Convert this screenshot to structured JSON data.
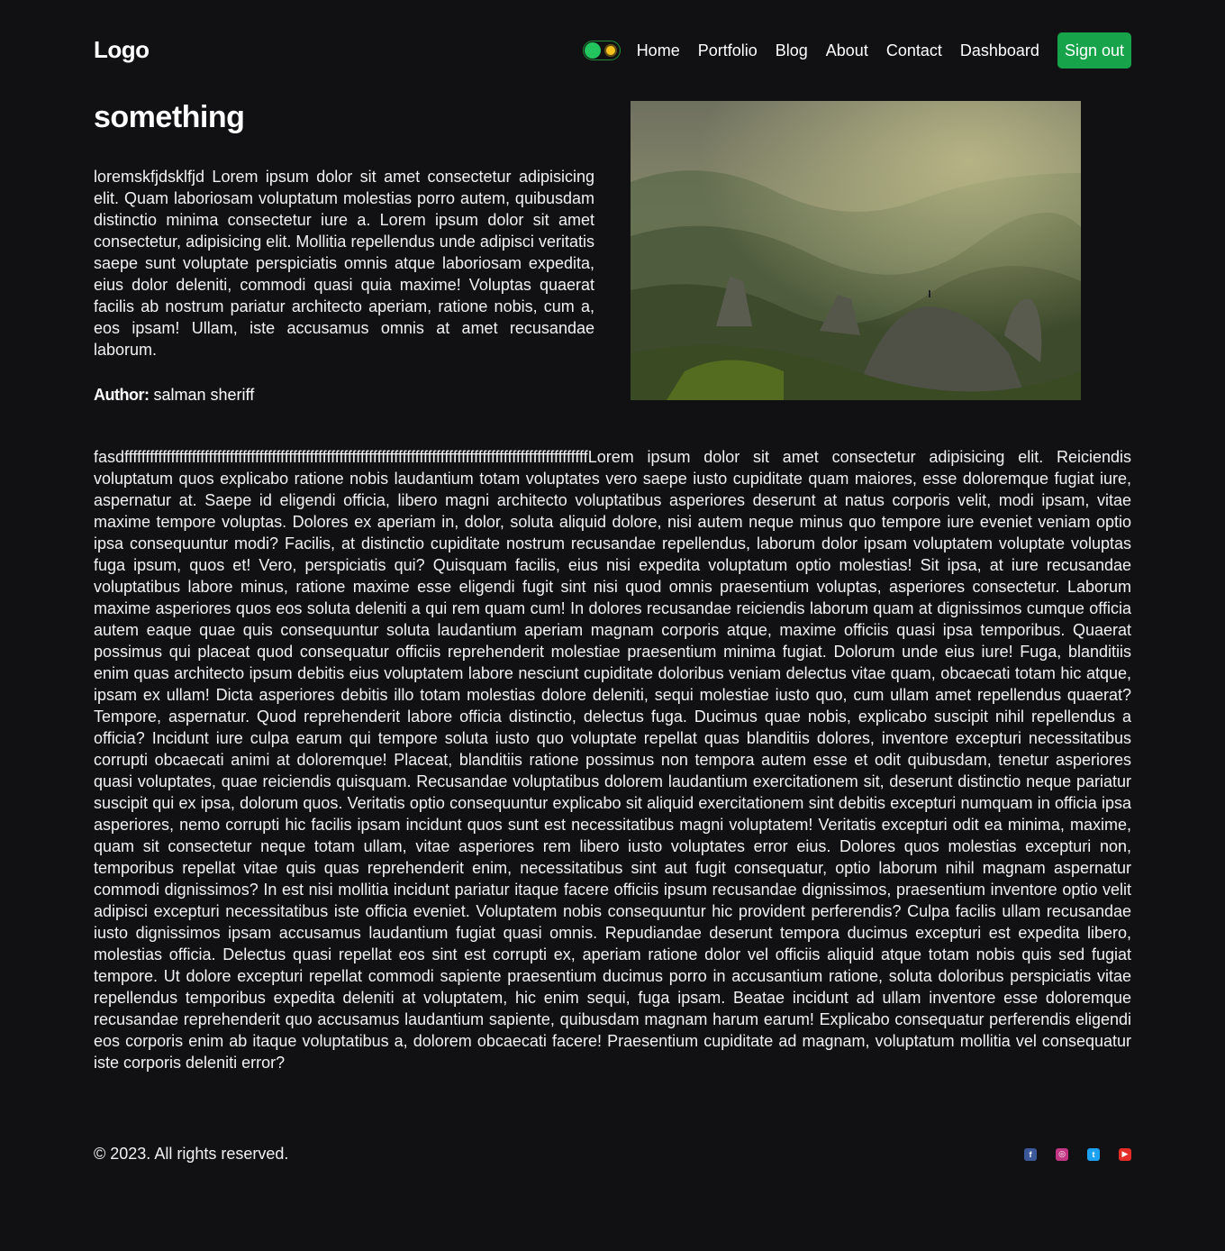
{
  "nav": {
    "logo": "Logo",
    "links": [
      "Home",
      "Portfolio",
      "Blog",
      "About",
      "Contact",
      "Dashboard"
    ],
    "signout": "Sign out"
  },
  "post": {
    "title": "something",
    "description": "loremskfjdsklfjd Lorem ipsum dolor sit amet consectetur adipisicing elit. Quam laboriosam voluptatum molestias porro autem, quibusdam distinctio minima consectetur iure a. Lorem ipsum dolor sit amet consectetur, adipisicing elit. Mollitia repellendus unde adipisci veritatis saepe sunt voluptate perspiciatis omnis atque laboriosam expedita, eius dolor deleniti, commodi quasi quia maxime! Voluptas quaerat facilis ab nostrum pariatur architecto aperiam, ratione nobis, cum a, eos ipsam! Ullam, iste accusamus omnis at amet recusandae laborum.",
    "author_label": "Author:",
    "author_name": "salman sheriff",
    "content_prefix": "fasdffffffffffffffffffffffffffffffffffffffffffffffffffffffffffffffffffffffffffffffffffffffffffffffffffffffffffffff",
    "content": "Lorem ipsum dolor sit amet consectetur adipisicing elit. Reiciendis voluptatum quos explicabo ratione nobis laudantium totam voluptates vero saepe iusto cupiditate quam maiores, esse doloremque fugiat iure, aspernatur at. Saepe id eligendi officia, libero magni architecto voluptatibus asperiores deserunt at natus corporis velit, modi ipsam, vitae maxime tempore voluptas. Dolores ex aperiam in, dolor, soluta aliquid dolore, nisi autem neque minus quo tempore iure eveniet veniam optio ipsa consequuntur modi? Facilis, at distinctio cupiditate nostrum recusandae repellendus, laborum dolor ipsam voluptatem voluptate voluptas fuga ipsum, quos et! Vero, perspiciatis qui? Quisquam facilis, eius nisi expedita voluptatum optio molestias! Sit ipsa, at iure recusandae voluptatibus labore minus, ratione maxime esse eligendi fugit sint nisi quod omnis praesentium voluptas, asperiores consectetur. Laborum maxime asperiores quos eos soluta deleniti a qui rem quam cum! In dolores recusandae reiciendis laborum quam at dignissimos cumque officia autem eaque quae quis consequuntur soluta laudantium aperiam magnam corporis atque, maxime officiis quasi ipsa temporibus. Quaerat possimus qui placeat quod consequatur officiis reprehenderit molestiae praesentium minima fugiat. Dolorum unde eius iure! Fuga, blanditiis enim quas architecto ipsum debitis eius voluptatem labore nesciunt cupiditate doloribus veniam delectus vitae quam, obcaecati totam hic atque, ipsam ex ullam! Dicta asperiores debitis illo totam molestias dolore deleniti, sequi molestiae iusto quo, cum ullam amet repellendus quaerat? Tempore, aspernatur. Quod reprehenderit labore officia distinctio, delectus fuga. Ducimus quae nobis, explicabo suscipit nihil repellendus a officia? Incidunt iure culpa earum qui tempore soluta iusto quo voluptate repellat quas blanditiis dolores, inventore excepturi necessitatibus corrupti obcaecati animi at doloremque! Placeat, blanditiis ratione possimus non tempora autem esse et odit quibusdam, tenetur asperiores quasi voluptates, quae reiciendis quisquam. Recusandae voluptatibus dolorem laudantium exercitationem sit, deserunt distinctio neque pariatur suscipit qui ex ipsa, dolorum quos. Veritatis optio consequuntur explicabo sit aliquid exercitationem sint debitis excepturi numquam in officia ipsa asperiores, nemo corrupti hic facilis ipsam incidunt quos sunt est necessitatibus magni voluptatem! Veritatis excepturi odit ea minima, maxime, quam sit consectetur neque totam ullam, vitae asperiores rem libero iusto voluptates error eius. Dolores quos molestias excepturi non, temporibus repellat vitae quis quas reprehenderit enim, necessitatibus sint aut fugit consequatur, optio laborum nihil magnam aspernatur commodi dignissimos? In est nisi mollitia incidunt pariatur itaque facere officiis ipsum recusandae dignissimos, praesentium inventore optio velit adipisci excepturi necessitatibus iste officia eveniet. Voluptatem nobis consequuntur hic provident perferendis? Culpa facilis ullam recusandae iusto dignissimos ipsam accusamus laudantium fugiat quasi omnis. Repudiandae deserunt tempora ducimus excepturi est expedita libero, molestias officia. Delectus quasi repellat eos sint est corrupti ex, aperiam ratione dolor vel officiis aliquid atque totam nobis quis sed fugiat tempore. Ut dolore excepturi repellat commodi sapiente praesentium ducimus porro in accusantium ratione, soluta doloribus perspiciatis vitae repellendus temporibus expedita deleniti at voluptatem, hic enim sequi, fuga ipsam. Beatae incidunt ad ullam inventore esse doloremque recusandae reprehenderit quo accusamus laudantium sapiente, quibusdam magnam harum earum! Explicabo consequatur perferendis eligendi eos corporis enim ab itaque voluptatibus a, dolorem obcaecati facere! Praesentium cupiditate ad magnam, voluptatum mollitia vel consequatur iste corporis deleniti error?"
  },
  "footer": {
    "copyright": "© 2023. All rights reserved.",
    "socials": [
      "facebook-icon",
      "instagram-icon",
      "twitter-icon",
      "youtube-icon"
    ]
  },
  "colors": {
    "background": "#111113",
    "accent": "#16a34a",
    "toggle_knob": "#22c55e",
    "sun": "#f6c21b"
  }
}
